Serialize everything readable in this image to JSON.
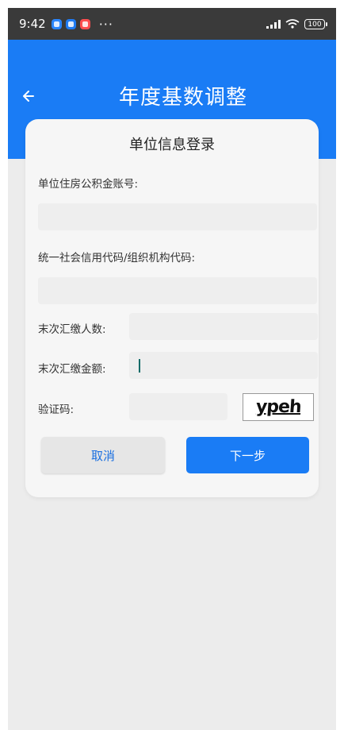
{
  "status_bar": {
    "time": "9:42",
    "ellipsis": "···",
    "battery": "100"
  },
  "header": {
    "title": "年度基数调整",
    "back_icon": "arrow-left-icon"
  },
  "form": {
    "title": "单位信息登录",
    "account_label": "单位住房公积金账号:",
    "account_value": "",
    "credit_code_label": "统一社会信用代码/组织机构代码:",
    "credit_code_value": "",
    "last_count_label": "末次汇缴人数:",
    "last_count_value": "",
    "last_amount_label": "末次汇缴金额:",
    "last_amount_value": "",
    "captcha_label": "验证码:",
    "captcha_value": "",
    "captcha_text": "ypeh",
    "cancel_label": "取消",
    "next_label": "下一步"
  },
  "colors": {
    "primary": "#1a7cf5",
    "cancel_text": "#1a6fe0",
    "cursor": "#0f6b68"
  }
}
